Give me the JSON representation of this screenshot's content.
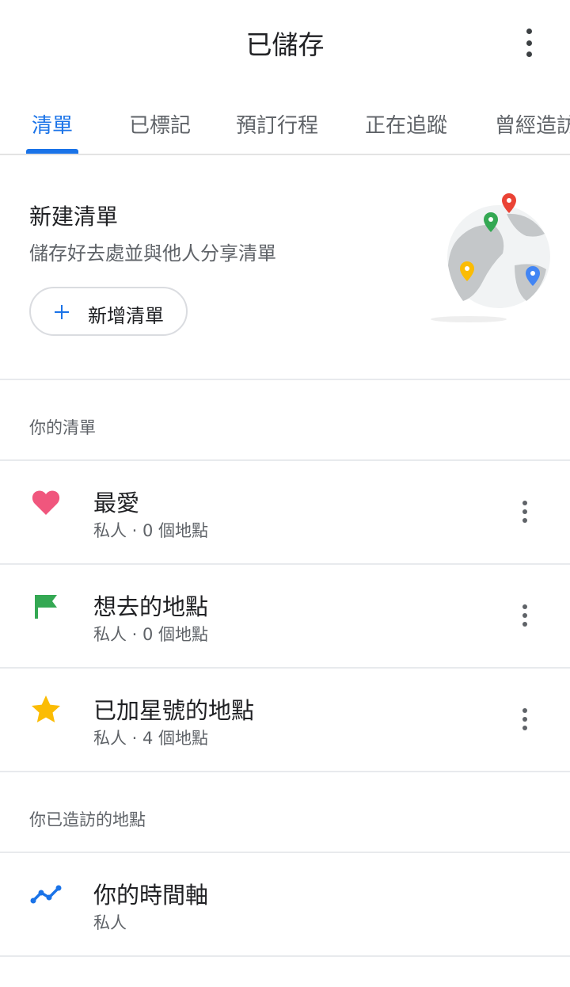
{
  "header": {
    "title": "已儲存"
  },
  "tabs": [
    {
      "label": "清單",
      "active": true
    },
    {
      "label": "已標記"
    },
    {
      "label": "預訂行程"
    },
    {
      "label": "正在追蹤"
    },
    {
      "label": "曾經造訪"
    }
  ],
  "new_list": {
    "title": "新建清單",
    "subtitle": "儲存好去處並與他人分享清單",
    "button_label": "新增清單"
  },
  "your_lists": {
    "heading": "你的清單",
    "items": [
      {
        "name": "最愛",
        "meta": "私人 · 0 個地點",
        "icon": "heart-icon",
        "color": "#f0567d"
      },
      {
        "name": "想去的地點",
        "meta": "私人 · 0 個地點",
        "icon": "flag-icon",
        "color": "#34a853"
      },
      {
        "name": "已加星號的地點",
        "meta": "私人 · 4 個地點",
        "icon": "star-icon",
        "color": "#fbbc04"
      }
    ]
  },
  "visited": {
    "heading": "你已造訪的地點",
    "items": [
      {
        "name": "你的時間軸",
        "meta": "私人",
        "icon": "timeline-icon",
        "color": "#1a73e8"
      }
    ]
  },
  "colors": {
    "accent": "#1a73e8",
    "text": "#202124",
    "secondary": "#5f6368",
    "divider": "#e8eaed"
  }
}
